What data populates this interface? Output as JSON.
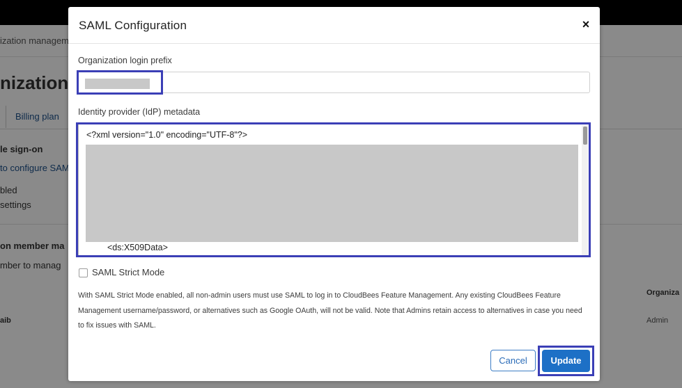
{
  "background": {
    "breadcrumb": "ization manageme",
    "page_title": "nization",
    "tab_billing": "Billing plan",
    "sso_heading": "le sign-on",
    "sso_link": "to configure SAM",
    "sso_status": "bled",
    "sso_settings": "settings",
    "member_heading": "on member ma",
    "member_desc": "mber to manag",
    "col_header": "Organiza",
    "row_name": "aib",
    "row_role": "Admin"
  },
  "modal": {
    "title": "SAML Configuration",
    "close_glyph": "×",
    "prefix_label": "Organization login prefix",
    "prefix_value": "",
    "metadata_label": "Identity provider (IdP) metadata",
    "metadata_first_line": "<?xml version=\"1.0\" encoding=\"UTF-8\"?>",
    "metadata_last_line": "<ds:X509Data>",
    "strict_mode_label": "SAML Strict Mode",
    "strict_mode_checked": false,
    "help_text": "With SAML Strict Mode enabled, all non-admin users must use SAML to log in to CloudBees Feature Management. Any existing CloudBees Feature Management username/password, or alternatives such as Google OAuth, will not be valid. Note that Admins retain access to alternatives in case you need to fix issues with SAML.",
    "cancel_label": "Cancel",
    "update_label": "Update"
  },
  "colors": {
    "highlight_border": "#3b3fb6",
    "primary_button": "#1d70c6",
    "redaction": "#c8c8c8"
  }
}
